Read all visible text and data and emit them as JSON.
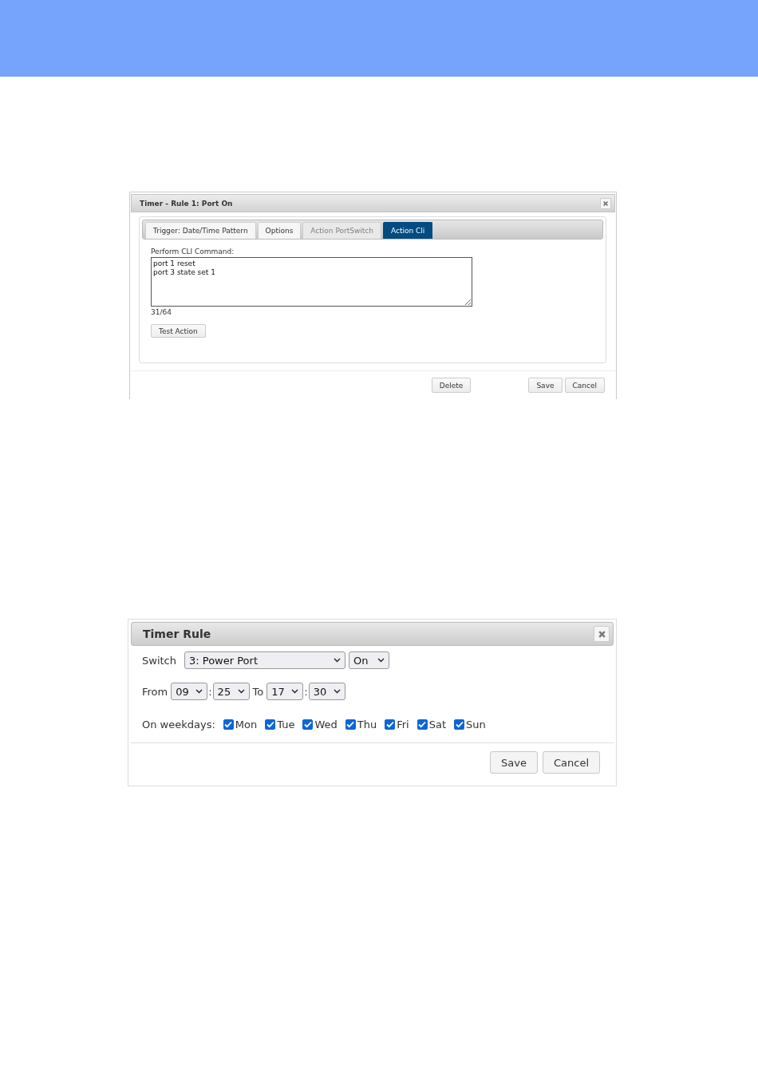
{
  "cli_dialog": {
    "title": "Timer - Rule 1: Port On",
    "tabs": [
      {
        "label": "Trigger: Date/Time Pattern",
        "selected": false,
        "disabled": false
      },
      {
        "label": "Options",
        "selected": false,
        "disabled": false
      },
      {
        "label": "Action PortSwitch",
        "selected": false,
        "disabled": true
      },
      {
        "label": "Action Cli",
        "selected": true,
        "disabled": false
      }
    ],
    "command_label": "Perform CLI Command:",
    "command": "port 1 reset\nport 3 state set 1",
    "counter": "31/64",
    "test_button": "Test Action",
    "buttons": [
      "Delete",
      "Save",
      "Cancel"
    ]
  },
  "timer_dialog": {
    "title": "Timer Rule",
    "switch_label": "Switch",
    "switch_value": "3: Power Port",
    "state_value": "On",
    "time": [
      {
        "kind": "label",
        "text": "From"
      },
      {
        "kind": "select",
        "text": "09"
      },
      {
        "kind": "separator",
        "text": ":"
      },
      {
        "kind": "select",
        "text": "25"
      },
      {
        "kind": "label",
        "text": "To"
      },
      {
        "kind": "select",
        "text": "17"
      },
      {
        "kind": "separator",
        "text": ":"
      },
      {
        "kind": "select",
        "text": "30"
      }
    ],
    "weekdays_label": "On weekdays:",
    "weekdays": [
      {
        "label": "Mon",
        "checked": true
      },
      {
        "label": "Tue",
        "checked": true
      },
      {
        "label": "Wed",
        "checked": true
      },
      {
        "label": "Thu",
        "checked": true
      },
      {
        "label": "Fri",
        "checked": true
      },
      {
        "label": "Sat",
        "checked": true
      },
      {
        "label": "Sun",
        "checked": true
      }
    ],
    "buttons": [
      "Save",
      "Cancel"
    ]
  }
}
